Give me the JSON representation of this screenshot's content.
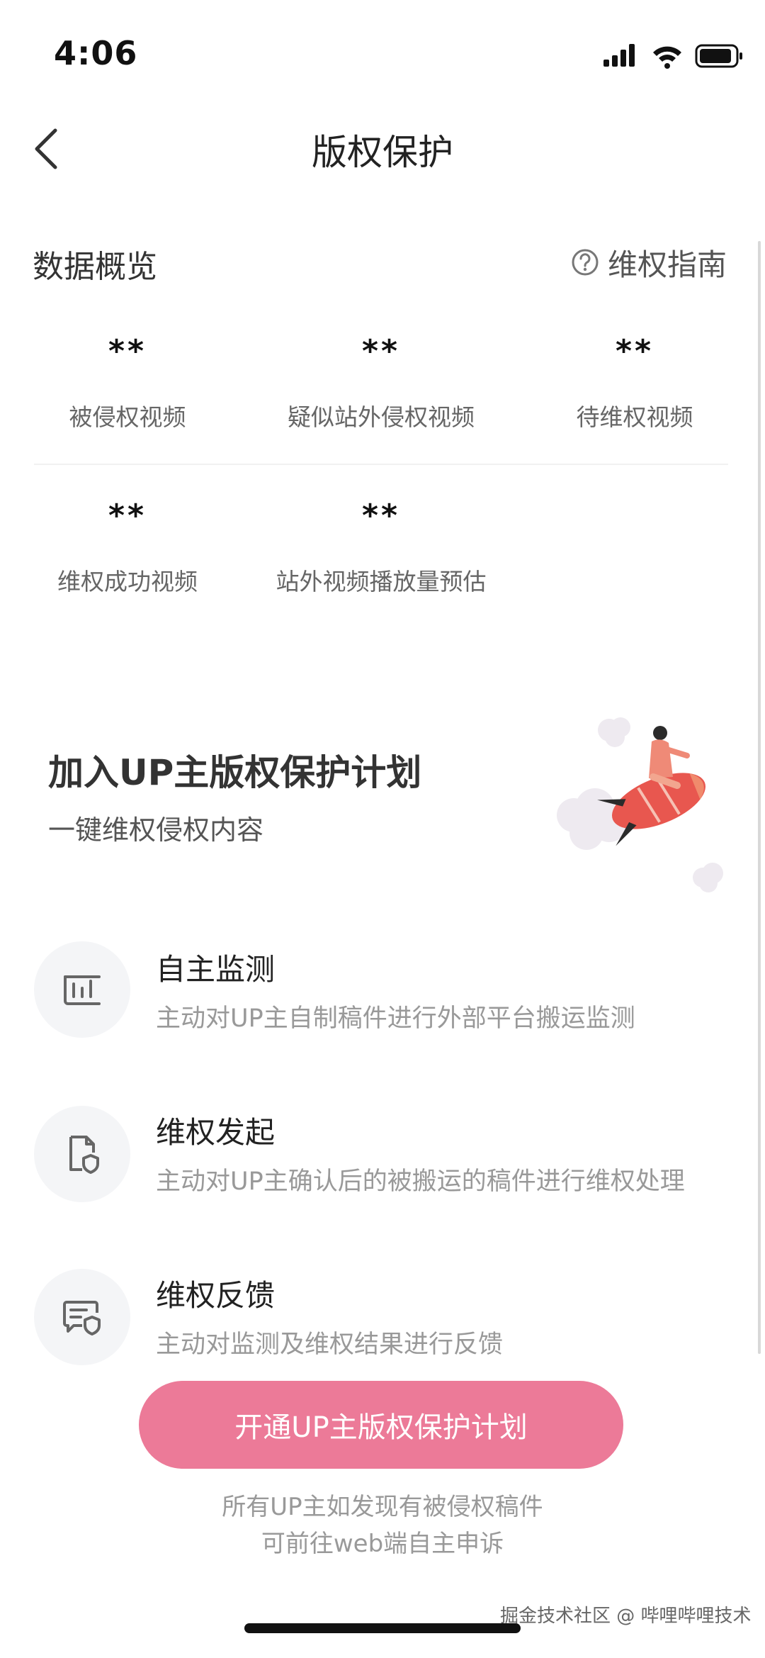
{
  "status": {
    "time": "4:06"
  },
  "nav": {
    "title": "版权保护"
  },
  "overview": {
    "title": "数据概览",
    "guide_label": "维权指南",
    "stats": [
      {
        "value": "**",
        "label": "被侵权视频"
      },
      {
        "value": "**",
        "label": "疑似站外侵权视频"
      },
      {
        "value": "**",
        "label": "待维权视频"
      },
      {
        "value": "**",
        "label": "维权成功视频"
      },
      {
        "value": "**",
        "label": "站外视频播放量预估"
      }
    ]
  },
  "plan": {
    "title": "加入UP主版权保护计划",
    "subtitle": "一键维权侵权内容"
  },
  "features": [
    {
      "title": "自主监测",
      "desc": "主动对UP主自制稿件进行外部平台搬运监测",
      "icon": "monitor-chart-icon"
    },
    {
      "title": "维权发起",
      "desc": "主动对UP主确认后的被搬运的稿件进行维权处理",
      "icon": "document-shield-icon"
    },
    {
      "title": "维权反馈",
      "desc": "主动对监测及维权结果进行反馈",
      "icon": "message-shield-icon"
    }
  ],
  "cta": {
    "label": "开通UP主版权保护计划"
  },
  "note": {
    "line1": "所有UP主如发现有被侵权稿件",
    "line2": "可前往web端自主申诉"
  },
  "watermark": "掘金技术社区 @ 哔哩哔哩技术",
  "colors": {
    "accent": "#ec7a98",
    "text": "#222222",
    "muted": "#999999"
  }
}
